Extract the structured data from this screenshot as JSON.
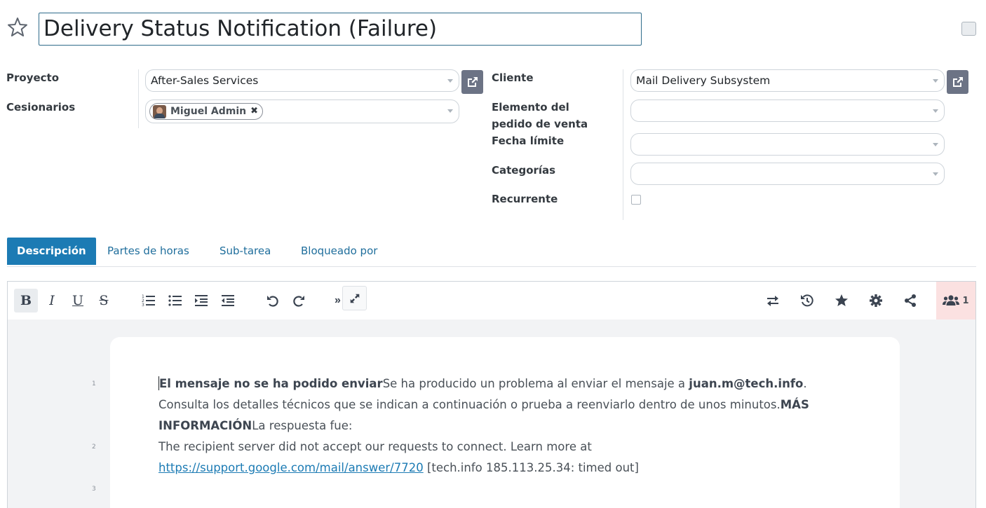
{
  "header": {
    "title": "Delivery Status Notification (Failure)"
  },
  "left_fields": {
    "project_label": "Proyecto",
    "project_value": "After-Sales Services",
    "assignees_label": "Cesionarios",
    "assignee_tag": "Miguel Admin"
  },
  "right_fields": {
    "customer_label": "Cliente",
    "customer_value": "Mail Delivery Subsystem",
    "sale_line_label_1": "Elemento del",
    "sale_line_label_2": "pedido de venta",
    "deadline_label": "Fecha límite",
    "categories_label": "Categorías",
    "recurrent_label": "Recurrente"
  },
  "tabs": [
    {
      "label": "Descripción",
      "active": true
    },
    {
      "label": "Partes de horas",
      "active": false
    },
    {
      "label": "Sub-tarea",
      "active": false
    },
    {
      "label": "Bloqueado por",
      "active": false
    }
  ],
  "toolbar": {
    "bold": "B",
    "italic": "I",
    "underline": "U",
    "strike": "S",
    "collaborators_count": "1",
    "icons": [
      "bold-icon",
      "italic-icon",
      "underline-icon",
      "strikethrough-icon",
      "numbered-list-icon",
      "bullet-list-icon",
      "indent-icon",
      "outdent-icon",
      "undo-icon",
      "redo-icon",
      "expand-icon",
      "compare-icon",
      "history-icon",
      "star-icon",
      "gear-icon",
      "share-icon",
      "users-icon"
    ]
  },
  "document": {
    "line_numbers": [
      "1",
      "2",
      "3"
    ],
    "p1_bold": "El mensaje no se ha podido enviar",
    "p1_text": "Se ha producido un problema al enviar el mensaje a ",
    "p1_email": "juan.m@tech.info",
    "p1_after_email": ".",
    "p1_line2": "Consulta los detalles técnicos que se indican a continuación o prueba a reenviarlo dentro de unos minutos.",
    "p1_more": "MÁS INFORMACIÓN",
    "p1_answer": "La respuesta fue:",
    "p2_text": "The recipient server did not accept our requests to connect. Learn more at",
    "p2_link": "https://support.google.com/mail/answer/7720",
    "p2_after_link": " [tech.info 185.113.25.34: timed out]"
  },
  "colors": {
    "primary": "#1c7bb4",
    "link": "#1c7bb4",
    "title_border": "#2e6b8a",
    "collab_bg": "#fbe1e1",
    "ext_button": "#6c7385"
  }
}
